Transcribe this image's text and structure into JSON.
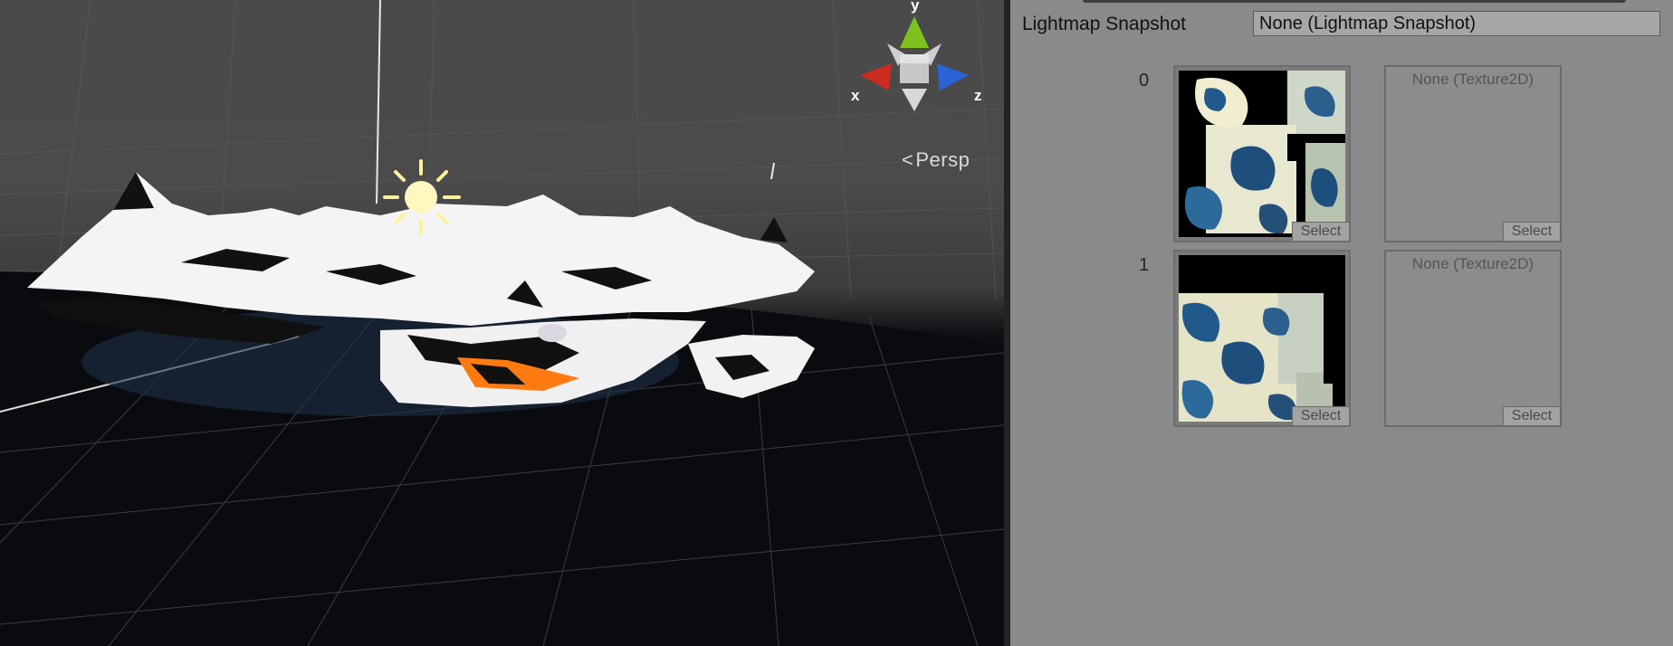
{
  "scene": {
    "view_mode": "Persp",
    "axes": {
      "x": "x",
      "y": "y",
      "z": "z"
    },
    "colors": {
      "x_axis": "#cc2b1f",
      "y_axis": "#7fc21e",
      "z_axis": "#2a62d8"
    }
  },
  "inspector": {
    "snapshot_label": "Lightmap Snapshot",
    "snapshot_value": "None (Lightmap Snapshot)",
    "lightmaps": [
      {
        "index": "0",
        "far_select": "Select",
        "near_label": "None (Texture2D)",
        "near_select": "Select"
      },
      {
        "index": "1",
        "far_select": "Select",
        "near_label": "None (Texture2D)",
        "near_select": "Select"
      }
    ]
  }
}
